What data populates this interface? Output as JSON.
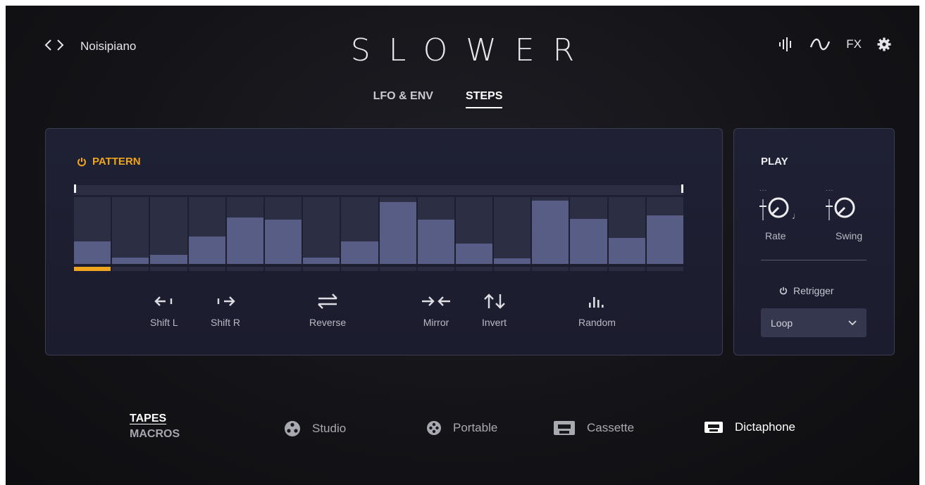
{
  "header": {
    "prev_label": "‹",
    "next_label": "›",
    "preset": "Noisipiano",
    "logo": "SLOWER",
    "fx_label": "FX",
    "icons": [
      "levels-icon",
      "lfo-wave-icon",
      "gear-icon"
    ]
  },
  "tabs": [
    {
      "label": "LFO & ENV",
      "active": false
    },
    {
      "label": "STEPS",
      "active": true
    }
  ],
  "pattern": {
    "title": "PATTERN",
    "accent_color": "#f0a51e",
    "step_levels": [
      0.34,
      0.1,
      0.14,
      0.41,
      0.7,
      0.66,
      0.1,
      0.34,
      0.93,
      0.66,
      0.31,
      0.08,
      0.95,
      0.67,
      0.39,
      0.73
    ],
    "active_step": 1,
    "actions": [
      {
        "glyph": "←ı",
        "label": "Shift L",
        "icon": "shift-left-icon"
      },
      {
        "glyph": "ı→",
        "label": "Shift R",
        "icon": "shift-right-icon"
      },
      {
        "glyph": "⇆",
        "label": "Reverse",
        "icon": "reverse-icon"
      },
      {
        "glyph": "→←",
        "label": "Mirror",
        "icon": "mirror-icon"
      },
      {
        "glyph": "↑↓",
        "label": "Invert",
        "icon": "invert-icon"
      },
      {
        "glyph": "ılıl.",
        "label": "Random",
        "icon": "random-icon"
      }
    ]
  },
  "play": {
    "title": "PLAY",
    "knobs": [
      {
        "label": "Rate",
        "dots": "...",
        "note": "♩"
      },
      {
        "label": "Swing",
        "dots": "..."
      }
    ],
    "retrigger_label": "Retrigger",
    "mode_value": "Loop"
  },
  "bottom_tabs": [
    {
      "label": "TAPES",
      "active": true
    },
    {
      "label": "MACROS",
      "active": false
    }
  ],
  "tapes": [
    {
      "label": "Studio",
      "icon": "reel-icon",
      "active": false
    },
    {
      "label": "Portable",
      "icon": "small-reel-icon",
      "active": false
    },
    {
      "label": "Cassette",
      "icon": "cassette-icon",
      "active": false
    },
    {
      "label": "Dictaphone",
      "icon": "dictaphone-icon",
      "active": true
    }
  ]
}
